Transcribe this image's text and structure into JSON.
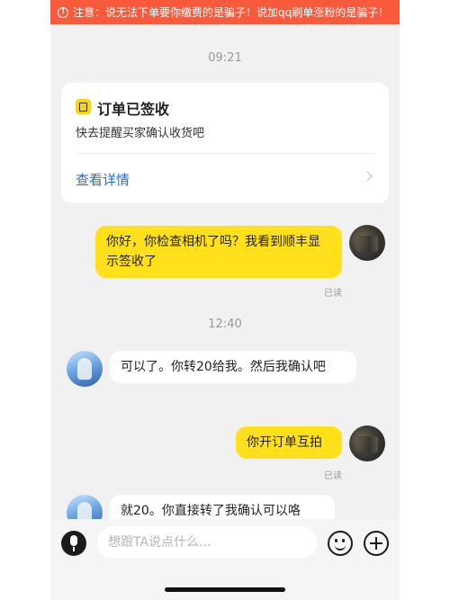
{
  "banner": {
    "icon": "warning-icon",
    "text": "注意：说无法下单要你缴费的是骗子！说加qq刷单涨粉的是骗子！"
  },
  "chat": {
    "timestamps": [
      "09:21",
      "12:40"
    ],
    "order_card": {
      "icon": "order-icon",
      "title": "订单已签收",
      "subtitle": "快去提醒买家确认收货吧",
      "link": "查看详情"
    },
    "messages": [
      {
        "from": "me",
        "text": "你好，你检查相机了吗？我看到顺丰显示签收了",
        "status": "已读"
      },
      {
        "from": "them",
        "text": "可以了。你转20给我。然后我确认吧"
      },
      {
        "from": "me",
        "text": "你开订单互拍",
        "status": "已读"
      },
      {
        "from": "them",
        "text": "就20。你直接转了我确认可以咯"
      }
    ]
  },
  "input_bar": {
    "placeholder": "想跟TA说点什么..."
  },
  "colors": {
    "banner": "#fa5a3c",
    "my_bubble": "#ffe01b",
    "link": "#1f6fd1",
    "background": "#f1f1f1"
  }
}
